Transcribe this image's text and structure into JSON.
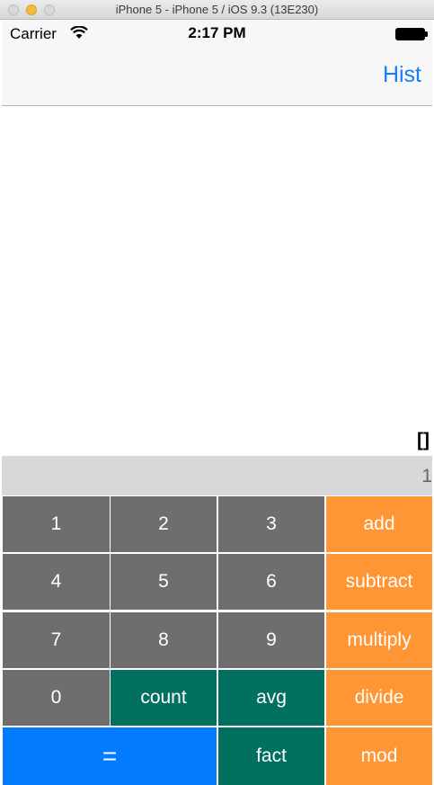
{
  "window": {
    "title": "iPhone 5 - iPhone 5 / iOS 9.3 (13E230)"
  },
  "status_bar": {
    "carrier": "Carrier",
    "time": "2:17 PM",
    "wifi_icon": "wifi-icon",
    "battery_icon": "battery-full-icon"
  },
  "nav": {
    "hist_label": "Hist"
  },
  "history": {
    "content": "[]"
  },
  "display": {
    "value": "1"
  },
  "colors": {
    "digit_key": "#6e6e6e",
    "operator_key": "#ff9533",
    "function_key": "#01705f",
    "equals_key": "#027bff",
    "nav_tint": "#157efb",
    "display_bar": "#d8d8d8"
  },
  "keys": {
    "k1": "1",
    "k2": "2",
    "k3": "3",
    "add": "add",
    "k4": "4",
    "k5": "5",
    "k6": "6",
    "subtract": "subtract",
    "k7": "7",
    "k8": "8",
    "k9": "9",
    "multiply": "multiply",
    "k0": "0",
    "count": "count",
    "avg": "avg",
    "divide": "divide",
    "equals": "=",
    "fact": "fact",
    "mod": "mod"
  }
}
